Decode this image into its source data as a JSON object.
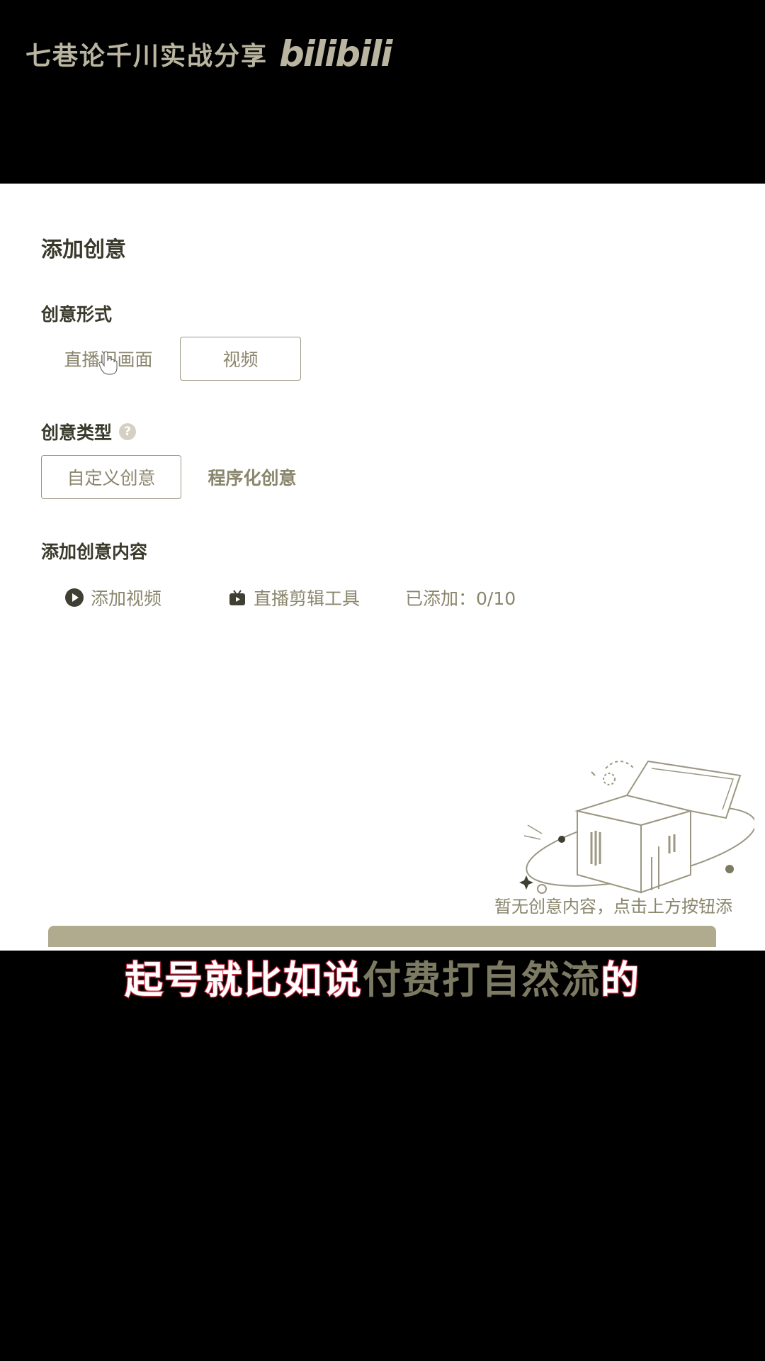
{
  "watermark": {
    "channel": "七巷论千川实战分享",
    "logo": "bilibili"
  },
  "panel": {
    "title": "添加创意",
    "creative_form": {
      "label": "创意形式",
      "options": [
        "直播间画面",
        "视频"
      ],
      "selected": "视频"
    },
    "creative_type": {
      "label": "创意类型",
      "help": "?",
      "options": [
        "自定义创意",
        "程序化创意"
      ],
      "selected": "自定义创意"
    },
    "creative_content": {
      "label": "添加创意内容",
      "add_video": "添加视频",
      "live_clip_tool": "直播剪辑工具",
      "added_count": "已添加：0/10"
    },
    "empty_state": "暂无创意内容，点击上方按钮添"
  },
  "subtitle": {
    "part1": "起号就比如说",
    "part2": "付费打自然流",
    "part3": "的"
  },
  "colors": {
    "accent_red": "#d8304a",
    "muted_text": "#8a866d",
    "dark_text": "#3a3a2c"
  }
}
